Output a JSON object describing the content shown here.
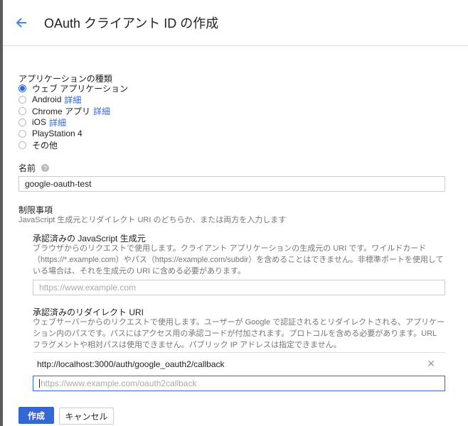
{
  "header": {
    "title": "OAuth クライアント ID の作成"
  },
  "app_type": {
    "label": "アプリケーションの種類",
    "options": [
      {
        "label": "ウェブ アプリケーション",
        "link": null,
        "selected": true
      },
      {
        "label": "Android",
        "link": "詳細",
        "selected": false
      },
      {
        "label": "Chrome アプリ",
        "link": "詳細",
        "selected": false
      },
      {
        "label": "iOS",
        "link": "詳細",
        "selected": false
      },
      {
        "label": "PlayStation 4",
        "link": null,
        "selected": false
      },
      {
        "label": "その他",
        "link": null,
        "selected": false
      }
    ]
  },
  "name": {
    "label": "名前",
    "value": "google-oauth-test"
  },
  "restrictions": {
    "title": "制限事項",
    "description": "JavaScript 生成元とリダイレクト URI のどちらか、または両方を入力します",
    "js_origins": {
      "title": "承認済みの JavaScript 生成元",
      "help": "ブラウザからのリクエストで使用します。クライアント アプリケーションの生成元の URI です。ワイルドカード（https://*.example.com）やパス（https://example.com/subdir）を含めることはできません。非標準ポートを使用している場合は、それを生成元の URI に含める必要があります。",
      "placeholder": "https://www.example.com"
    },
    "redirect_uris": {
      "title": "承認済みのリダイレクト URI",
      "help": "ウェブサーバーからのリクエストで使用します。ユーザーが Google で認証されるとリダイレクトされる、アプリケーション内のパスです。パスにはアクセス用の承認コードが付加されます。プロトコルを含める必要があります。URL フラグメントや相対パスは使用できません。パブリック IP アドレスは指定できません。",
      "entries": [
        "http://localhost:3000/auth/google_oauth2/callback"
      ],
      "placeholder": "https://www.example.com/oauth2callback"
    }
  },
  "actions": {
    "create": "作成",
    "cancel": "キャンセル"
  }
}
